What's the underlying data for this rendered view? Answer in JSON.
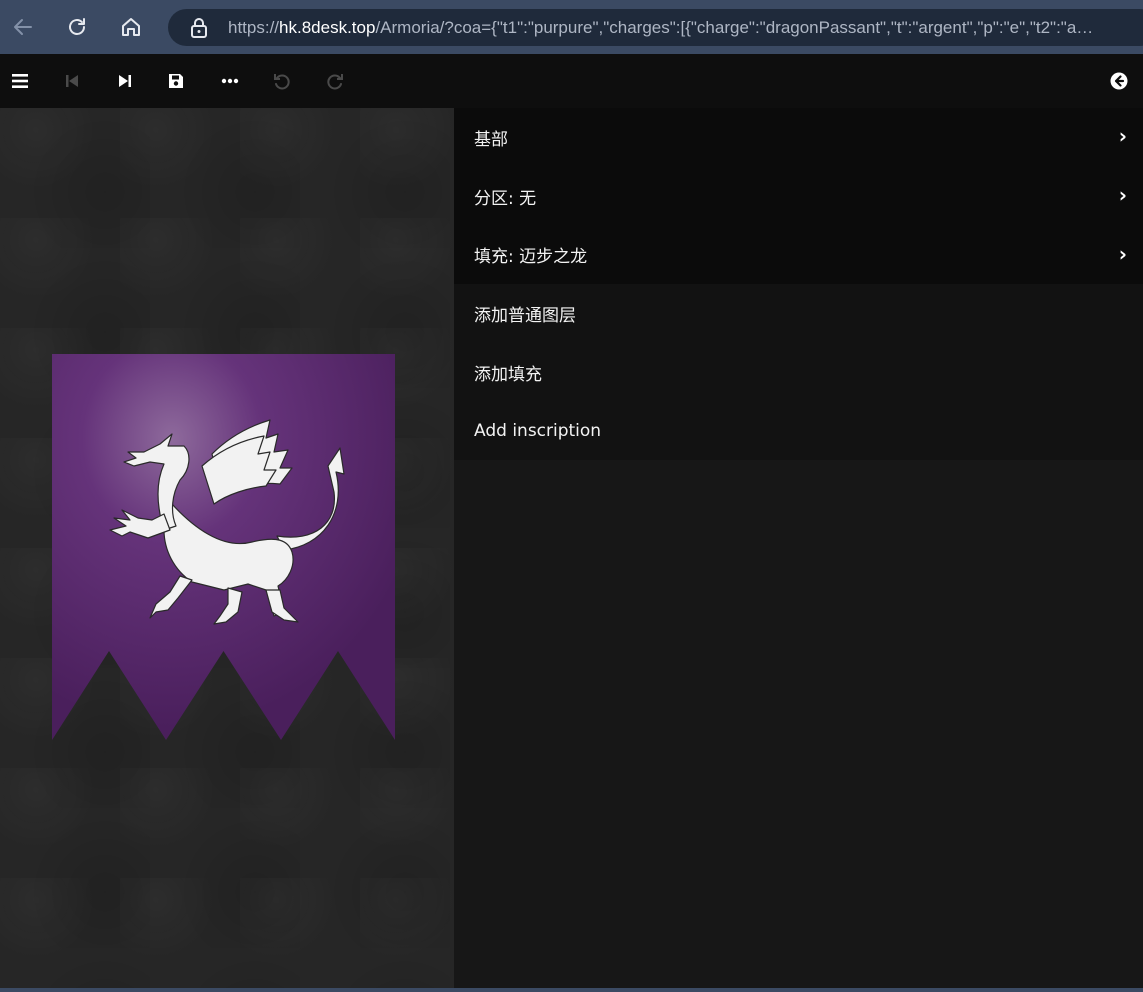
{
  "browser": {
    "url_scheme": "https://",
    "url_host": "hk.8desk.top",
    "url_rest": "/Armoria/?coa={\"t1\":\"purpure\",\"charges\":[{\"charge\":\"dragonPassant\",\"t\":\"argent\",\"p\":\"e\",\"t2\":\"a…"
  },
  "toolbar": {
    "icons": [
      "menu-icon",
      "skip-back-icon",
      "skip-forward-icon",
      "save-icon",
      "more-icon",
      "undo-icon",
      "redo-icon",
      "back-icon"
    ]
  },
  "menu": {
    "items": [
      {
        "label": "基部",
        "chevron": "›"
      },
      {
        "label": "分区: 无",
        "chevron": "›"
      },
      {
        "label": "填充: 迈步之龙",
        "chevron": "›"
      },
      {
        "label": "添加普通图层"
      },
      {
        "label": "添加填充"
      },
      {
        "label": "Add inscription"
      }
    ]
  },
  "colors": {
    "banner_field": "#57276a",
    "charge": "#f2f2f2",
    "browser_chrome": "#3b4a63",
    "toolbar_bg": "#0e0e0e"
  }
}
